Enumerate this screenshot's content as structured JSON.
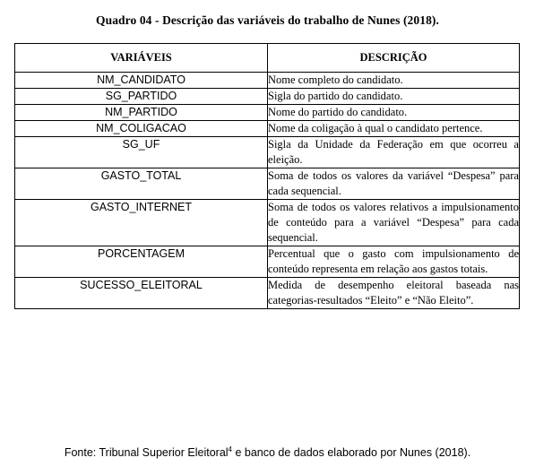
{
  "caption": "Quadro 04 - Descrição das variáveis do trabalho de Nunes (2018).",
  "table": {
    "headers": [
      "VARIÁVEIS",
      "DESCRIÇÃO"
    ],
    "rows": [
      {
        "variable": "NM_CANDIDATO",
        "description": "Nome completo do candidato."
      },
      {
        "variable": "SG_PARTIDO",
        "description": "Sigla do partido do candidato."
      },
      {
        "variable": "NM_PARTIDO",
        "description": "Nome do partido do candidato."
      },
      {
        "variable": "NM_COLIGACAO",
        "description": "Nome da coligação à qual o candidato pertence."
      },
      {
        "variable": "SG_UF",
        "description": "Sigla da Unidade da Federação em que ocorreu a eleição."
      },
      {
        "variable": "GASTO_TOTAL",
        "description": "Soma de todos os valores da variável “Despesa” para cada sequencial."
      },
      {
        "variable": "GASTO_INTERNET",
        "description": "Soma de todos os valores relativos a impulsionamento de conteúdo para a variável “Despesa” para cada sequencial."
      },
      {
        "variable": "PORCENTAGEM",
        "description": "Percentual que o gasto com impulsionamento de conteúdo representa em relação aos gastos totais."
      },
      {
        "variable": "SUCESSO_ELEITORAL",
        "description": "Medida de desempenho eleitoral baseada nas categorias-resultados “Eleito” e “Não Eleito”."
      }
    ]
  },
  "source": {
    "before": "Fonte: Tribunal Superior Eleitoral",
    "footnote_mark": "4",
    "after": " e banco de dados elaborado por Nunes (2018)."
  }
}
